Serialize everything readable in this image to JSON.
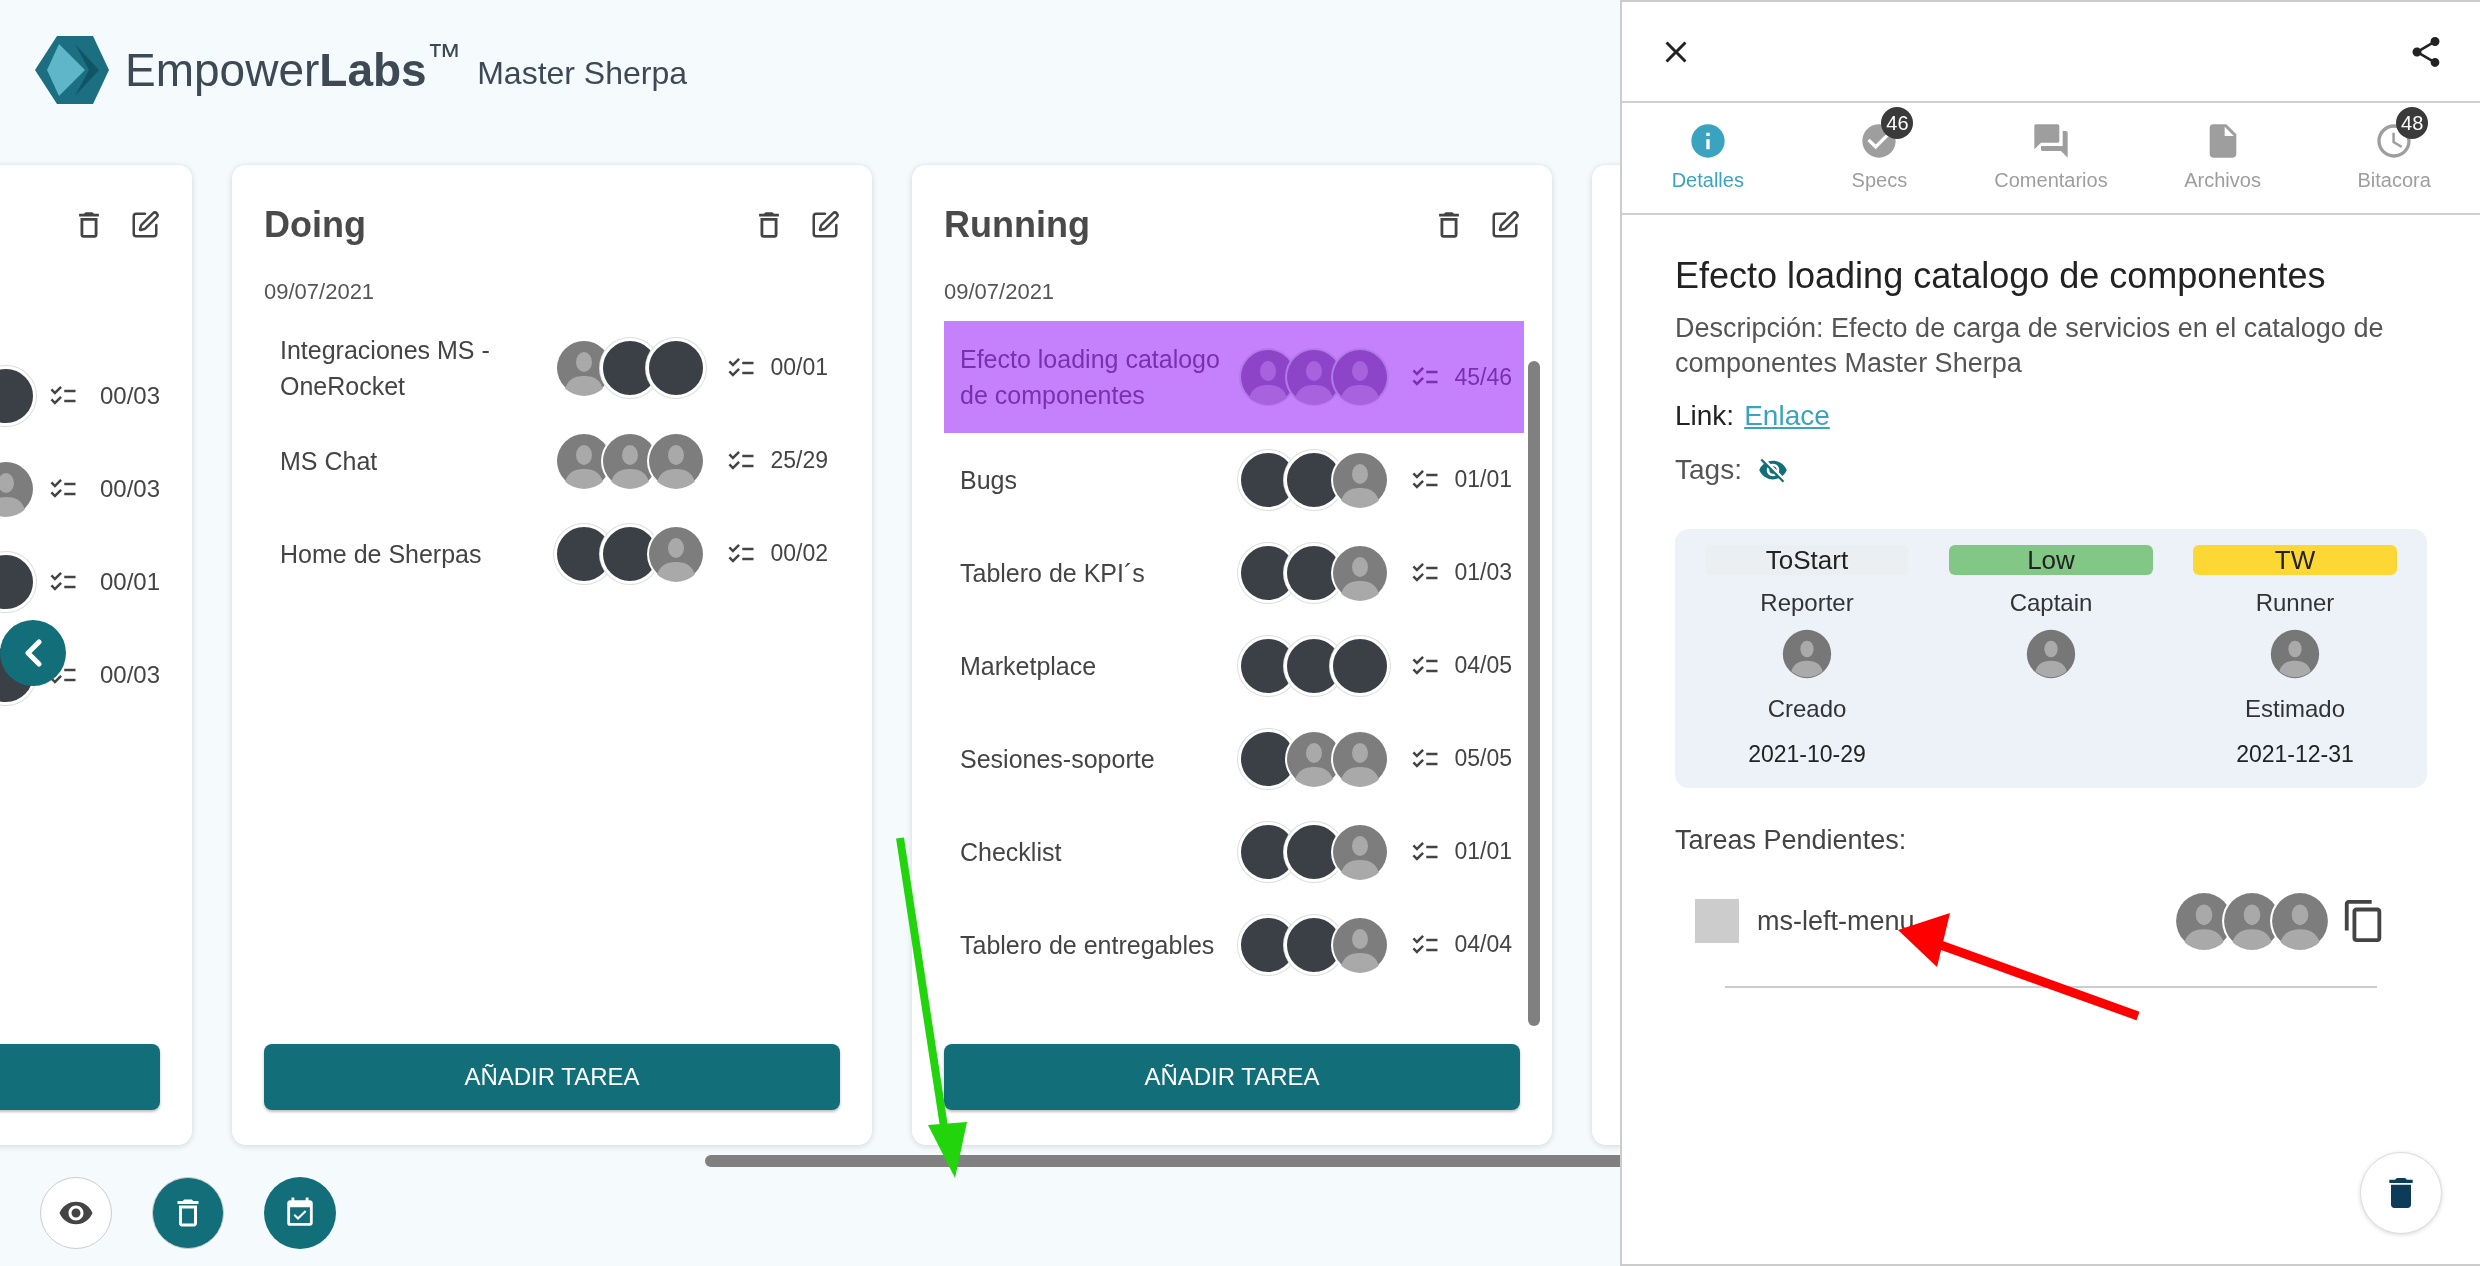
{
  "header": {
    "brand": "Empower**Labs**$^{™}$",
    "product": "Master Sherpa"
  },
  "board": {
    "columns": [
      {
        "tasks": [
          {
            "count": "00/03",
            "selected": false,
            "avatars": [
              {
                "kind": "photo"
              }
            ]
          },
          {
            "count": "00/03",
            "selected": false,
            "avatars": [
              {
                "kind": "blank"
              }
            ]
          },
          {
            "count": "00/01",
            "selected": false,
            "avatars": [
              {
                "kind": "photo"
              }
            ]
          },
          {
            "count": "00/03",
            "selected": false,
            "avatars": [
              {
                "kind": "photo"
              }
            ]
          }
        ]
      },
      {
        "title": "Doing",
        "date": "09/07/2021",
        "tasks": [
          {
            "name": "Integraciones MS - OneRocket",
            "count": "00/01",
            "selected": false,
            "avatars": [
              {
                "kind": "blank"
              },
              {
                "kind": "photo"
              },
              {
                "kind": "photo"
              }
            ]
          },
          {
            "name": "MS Chat",
            "count": "25/29",
            "selected": false,
            "avatars": [
              {
                "kind": "blank"
              },
              {
                "kind": "blank"
              },
              {
                "kind": "blank"
              }
            ]
          },
          {
            "name": "Home de Sherpas",
            "count": "00/02",
            "selected": false,
            "avatars": [
              {
                "kind": "photo"
              },
              {
                "kind": "photo"
              },
              {
                "kind": "blank"
              }
            ]
          }
        ],
        "add_button_label": "AÑADIR TAREA"
      },
      {
        "title": "Running",
        "date": "09/07/2021",
        "scrollable": true,
        "tasks": [
          {
            "name": "Efecto loading catalogo de componentes",
            "count": "45/46",
            "selected": true,
            "avatars": [
              {
                "kind": "blank"
              },
              {
                "kind": "blank"
              },
              {
                "kind": "blank"
              }
            ]
          },
          {
            "name": "Bugs",
            "count": "01/01",
            "selected": false,
            "avatars": [
              {
                "kind": "photo"
              },
              {
                "kind": "photo"
              },
              {
                "kind": "blank"
              }
            ]
          },
          {
            "name": "Tablero de KPI´s",
            "count": "01/03",
            "selected": false,
            "avatars": [
              {
                "kind": "photo"
              },
              {
                "kind": "photo"
              },
              {
                "kind": "blank"
              }
            ]
          },
          {
            "name": "Marketplace",
            "count": "04/05",
            "selected": false,
            "avatars": [
              {
                "kind": "photo"
              },
              {
                "kind": "photo"
              },
              {
                "kind": "photo"
              }
            ]
          },
          {
            "name": "Sesiones-soporte",
            "count": "05/05",
            "selected": false,
            "avatars": [
              {
                "kind": "photo"
              },
              {
                "kind": "blank"
              },
              {
                "kind": "blank"
              }
            ]
          },
          {
            "name": "Checklist",
            "count": "01/01",
            "selected": false,
            "avatars": [
              {
                "kind": "photo"
              },
              {
                "kind": "photo"
              },
              {
                "kind": "blank"
              }
            ]
          },
          {
            "name": "Tablero de entregables",
            "count": "04/04",
            "selected": false,
            "avatars": [
              {
                "kind": "photo"
              },
              {
                "kind": "photo"
              },
              {
                "kind": "blank"
              }
            ]
          }
        ],
        "add_button_label": "AÑADIR TAREA"
      }
    ]
  },
  "panel": {
    "tabs": [
      {
        "kind": "info",
        "label": "Detalles",
        "selected": true
      },
      {
        "kind": "check",
        "label": "Specs",
        "badge": "46",
        "selected": false
      },
      {
        "kind": "comments",
        "label": "Comentarios",
        "selected": false
      },
      {
        "kind": "file",
        "label": "Archivos",
        "selected": false
      },
      {
        "kind": "clock",
        "label": "Bitacora",
        "badge": "48",
        "selected": false
      }
    ],
    "title": "Efecto loading catalogo de componentes",
    "description_label": "Descripción:",
    "description": "Efecto de carga de servicios en el catalogo de componentes Master Sherpa",
    "link_label": "Link:",
    "link": "Enlace",
    "tags_label": "Tags:",
    "info": [
      {
        "tag": "ToStart",
        "color": "#eceff1",
        "role": "Reporter",
        "date_label": "Creado",
        "date": "2021-10-29"
      },
      {
        "tag": "Low",
        "color": "#82c785",
        "role": "Captain"
      },
      {
        "tag": "TW",
        "color": "#fdd835",
        "role": "Runner",
        "date_label": "Estimado",
        "date": "2021-12-31"
      }
    ],
    "pending_title": "Tareas Pendientes:",
    "pending": [
      {
        "name": "ms-left-menu",
        "checked": false,
        "avatars": [
          {
            "kind": "blank"
          },
          {
            "kind": "blank"
          },
          {
            "kind": "blank"
          }
        ]
      }
    ]
  }
}
